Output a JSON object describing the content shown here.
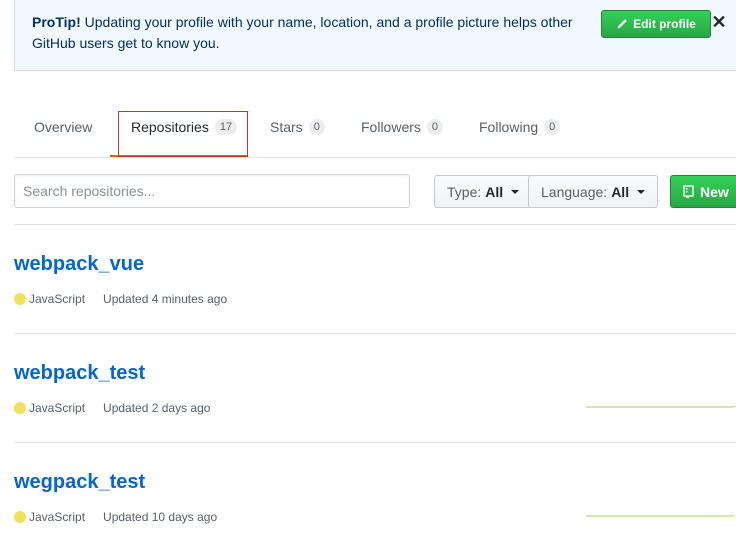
{
  "protip": {
    "label": "ProTip!",
    "message": " Updating your profile with your name, location, and a profile picture helps other GitHub users get to know you.",
    "edit_button": "Edit profile",
    "close_symbol": "✕"
  },
  "tabs": [
    {
      "label": "Overview",
      "count": null
    },
    {
      "label": "Repositories",
      "count": "17"
    },
    {
      "label": "Stars",
      "count": "0"
    },
    {
      "label": "Followers",
      "count": "0"
    },
    {
      "label": "Following",
      "count": "0"
    }
  ],
  "filters": {
    "search_placeholder": "Search repositories...",
    "type_label": "Type:",
    "type_value": "All",
    "language_label": "Language:",
    "language_value": "All",
    "new_button": "New"
  },
  "repos": [
    {
      "name": "webpack_vue",
      "language": "JavaScript",
      "updated": "Updated 4 minutes ago",
      "sparkline": false
    },
    {
      "name": "webpack_test",
      "language": "JavaScript",
      "updated": "Updated 2 days ago",
      "sparkline": true
    },
    {
      "name": "wegpack_test",
      "language": "JavaScript",
      "updated": "Updated 10 days ago",
      "sparkline": true
    }
  ],
  "colors": {
    "accent_green": "#28a745",
    "link_blue": "#0366d6",
    "javascript": "#f1e05a",
    "annotation_red": "#d0302a"
  }
}
